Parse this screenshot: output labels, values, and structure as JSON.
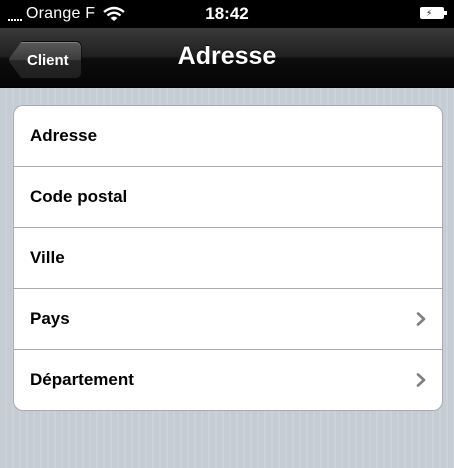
{
  "status_bar": {
    "carrier": "Orange F",
    "time": "18:42",
    "icons": [
      "signal-icon",
      "wifi-icon",
      "battery-icon"
    ]
  },
  "nav_bar": {
    "back_label": "Client",
    "title": "Adresse"
  },
  "rows": [
    {
      "label": "Adresse",
      "has_disclosure": false
    },
    {
      "label": "Code postal",
      "has_disclosure": false
    },
    {
      "label": "Ville",
      "has_disclosure": false
    },
    {
      "label": "Pays",
      "has_disclosure": true
    },
    {
      "label": "Département",
      "has_disclosure": true
    }
  ],
  "colors": {
    "background": "#c5ccd4",
    "nav_bar": "#000000",
    "cell_border": "#a9abad",
    "chevron": "#7f7f7f"
  }
}
